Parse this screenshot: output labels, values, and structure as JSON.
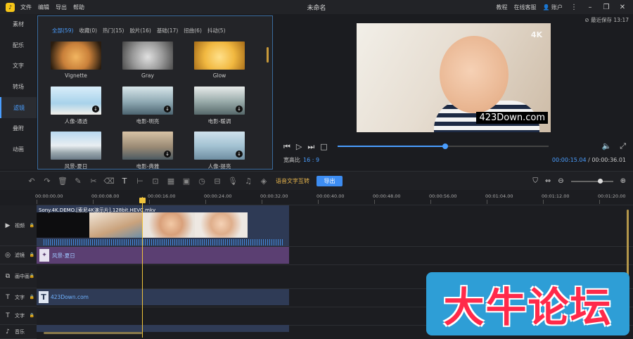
{
  "titlebar": {
    "logo": "♪",
    "menus": [
      "文件",
      "编辑",
      "导出",
      "帮助"
    ],
    "title": "未命名",
    "right": [
      "教程",
      "在线客服",
      "账户"
    ]
  },
  "leftnav": {
    "items": [
      "素材",
      "配乐",
      "文字",
      "转场",
      "滤镜",
      "叠附",
      "动画"
    ]
  },
  "filters": {
    "tabs": [
      "全部(59)",
      "收藏(0)",
      "热门(15)",
      "胶片(16)",
      "基础(17)",
      "扭曲(6)",
      "抖动(5)"
    ],
    "items": [
      {
        "label": "Vignette"
      },
      {
        "label": "Gray"
      },
      {
        "label": "Glow"
      },
      {
        "label": "人像-通透"
      },
      {
        "label": "电影-明亮"
      },
      {
        "label": "电影-暖调"
      },
      {
        "label": "风景-夏日"
      },
      {
        "label": "电影-典雅"
      },
      {
        "label": "人像-提亮"
      }
    ]
  },
  "preview": {
    "autosave": "最近保存 13:17",
    "badge": "4K",
    "watermark": "423Down.com",
    "ratio_label": "宽高比",
    "ratio_value": "16 : 9",
    "time_current": "00:00:15.04",
    "time_sep": "/",
    "time_total": "00:00:36.01",
    "progress": 0.51
  },
  "toolbar": {
    "tts_label": "语音文字互转",
    "export_label": "导出"
  },
  "timeline": {
    "ticks": [
      "00:00:00.00",
      "00:00:08.00",
      "00:00:16.00",
      "00:00:24.00",
      "00:00:32.00",
      "00:00:40.00",
      "00:00:48.00",
      "00:00:56.00",
      "00:01:04.00",
      "00:01:12.00",
      "00:01:20.00"
    ],
    "tracks": [
      "视频",
      "滤镜",
      "画中画",
      "文字",
      "文字",
      "音乐"
    ],
    "video_clip_title": "Sony.4K.DEMO.[索尼4K演示片].128bit.HEVC.mkv",
    "filter_clip_label": "风景-夏日",
    "text_clip_label": "423Down.com"
  },
  "banner": {
    "text": "大牛论坛"
  }
}
